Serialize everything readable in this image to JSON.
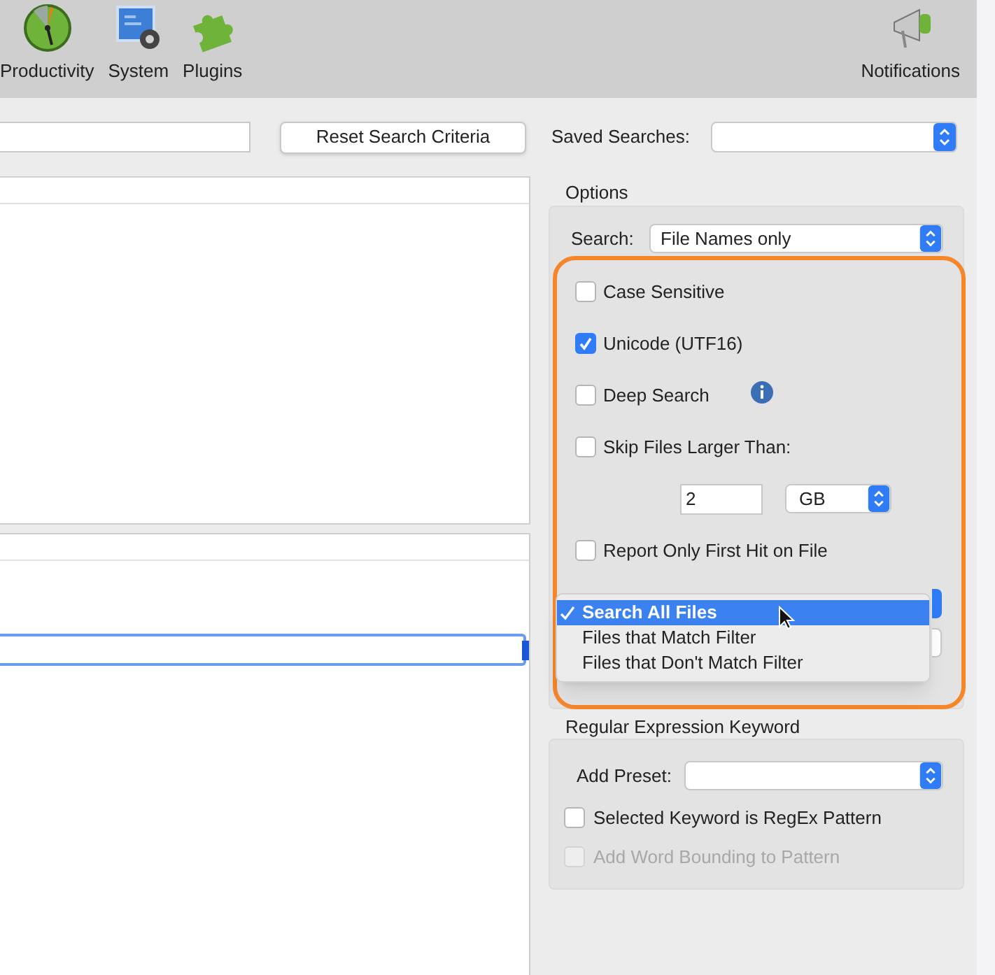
{
  "toolbar": {
    "items": [
      {
        "label": "Productivity",
        "kind": "gauge"
      },
      {
        "label": "System",
        "kind": "system"
      },
      {
        "label": "Plugins",
        "kind": "plugins"
      }
    ],
    "right_item": {
      "label": "Notifications",
      "kind": "megaphone"
    }
  },
  "search_bar": {
    "reset_button": "Reset Search Criteria",
    "saved_searches_label": "Saved Searches:"
  },
  "options": {
    "title": "Options",
    "search_label": "Search:",
    "search_value": "File Names only",
    "rows": [
      {
        "kind": "checkbox",
        "label": "Case Sensitive",
        "checked": false,
        "info": false
      },
      {
        "kind": "checkbox",
        "label": "Unicode (UTF16)",
        "checked": true,
        "info": false
      },
      {
        "kind": "checkbox",
        "label": "Deep Search",
        "checked": false,
        "info": true
      },
      {
        "kind": "checkbox",
        "label": "Skip Files Larger Than:",
        "checked": false,
        "info": false
      },
      {
        "kind": "size",
        "value": "2",
        "unit": "GB"
      },
      {
        "kind": "checkbox",
        "label": "Report Only First Hit on File",
        "checked": false,
        "info": false
      }
    ]
  },
  "filter_menu": {
    "items": [
      {
        "label": "Search All Files",
        "selected": true
      },
      {
        "label": "Files that Match Filter",
        "selected": false
      },
      {
        "label": "Files that Don't Match Filter",
        "selected": false
      }
    ]
  },
  "regex": {
    "title": "Regular Expression Keyword",
    "preset_label": "Add Preset:",
    "checkboxes": [
      {
        "label": "Selected Keyword is RegEx Pattern",
        "checked": false,
        "disabled": false
      },
      {
        "label": "Add Word Bounding to Pattern",
        "checked": false,
        "disabled": true
      }
    ]
  }
}
